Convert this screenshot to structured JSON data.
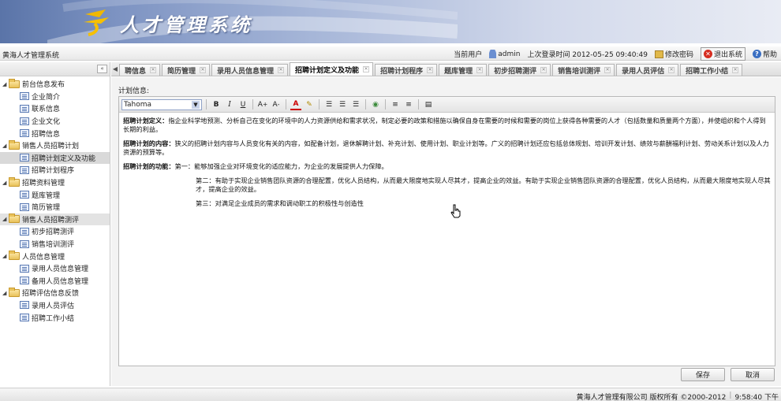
{
  "app": {
    "title": "人才管理系统",
    "system_name": "黄海人才管理系统"
  },
  "infobar": {
    "current_user_label": "当前用户",
    "user": "admin",
    "last_login": "上次登录时间 2012-05-25 09:40:49",
    "change_password": "修改密码",
    "exit": "退出系统",
    "help": "帮助"
  },
  "sidebar": {
    "groups": [
      {
        "label": "前台信息发布",
        "items": [
          "企业简介",
          "联系信息",
          "企业文化",
          "招聘信息"
        ]
      },
      {
        "label": "销售人员招聘计划",
        "items": [
          "招聘计划定义及功能",
          "招聘计划程序"
        ]
      },
      {
        "label": "招聘资料管理",
        "items": [
          "题库管理",
          "简历管理"
        ]
      },
      {
        "label": "销售人员招聘测评",
        "items": [
          "初步招聘测评",
          "销售培训测评"
        ]
      },
      {
        "label": "人员信息管理",
        "items": [
          "录用人员信息管理",
          "备用人员信息管理"
        ]
      },
      {
        "label": "招聘评估信息反馈",
        "items": [
          "录用人员评估",
          "招聘工作小结"
        ]
      }
    ]
  },
  "tabs": [
    "聘信息",
    "简历管理",
    "录用人员信息管理",
    "招聘计划定义及功能",
    "招聘计划程序",
    "题库管理",
    "初步招聘测评",
    "销售培训测评",
    "录用人员评估",
    "招聘工作小结"
  ],
  "active_tab": "招聘计划定义及功能",
  "form": {
    "label": "计划信息:",
    "font": "Tahoma",
    "p1_title": "招聘计划定义：",
    "p1_text": "指企业科学地预测、分析自己在变化的环境中的人力资源供给和需求状况，制定必要的政策和措施以确保自身在需要的时候和需要的岗位上获得各种需要的人才（包括数量和质量两个方面），并使组织和个人得到长期的利益。",
    "p2_title": "招聘计划的内容：",
    "p2_text": "狭义的招聘计划内容与人员变化有关的内容，如配备计划，退休解聘计划、补充计划、使用计划、职业计划等。广义的招聘计划还应包括总体规划、培训开发计划、绩效与薪酬福利计划、劳动关系计划以及人力资源的预算等。",
    "p3_title": "招聘计划的功能：",
    "p3_text": "第一：能够加强企业对环境变化的适应能力，为企业的发展提供人力保障。",
    "p4_text": "第二：有助于实现企业销售团队资源的合理配置，优化人员结构，从而最大限度地实现人尽其才，提高企业的效益。有助于实现企业销售团队资源的合理配置，优化人员结构，从而最大限度地实现人尽其才，提高企业的效益。",
    "p5_text": "第三：对满足企业成员的需求和调动职工的积极性与创造性",
    "save": "保存",
    "cancel": "取消"
  },
  "footer": {
    "copyright": "黄海人才管理有限公司 版权所有 ©2000-2012",
    "time": "9:58:40 下午"
  }
}
